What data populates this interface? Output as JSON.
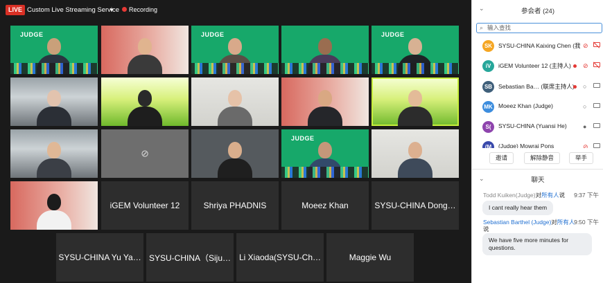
{
  "topbar": {
    "live_badge": "LIVE",
    "stream_label": "Custom Live Streaming Service",
    "recording_label": "Recording"
  },
  "tiles": {
    "volunteer": "iGEM Volunteer 12",
    "shriya": "Shriya PHADNIS",
    "moeez": "Moeez Khan",
    "sysu_dong": "SYSU-CHINA Dong…",
    "sysu_yu": "SYSU-CHINA Yu Ya…",
    "sysu_siju": "SYSU-CHINA（Siju…",
    "li_xiaoda": "Li Xiaoda(SYSU-Ch…",
    "maggie": "Maggie Wu",
    "judge_logo": "JUDGE"
  },
  "participants_panel": {
    "title": "参会者 (24)",
    "search_placeholder": "输入查找",
    "participants": [
      {
        "initials": "SK",
        "color": "#f5a623",
        "name": "SYSU-CHINA Kaixing Chen (我)",
        "recording": false,
        "mic": "muted",
        "cam": "off"
      },
      {
        "initials": "iV",
        "color": "#26a69a",
        "name": "iGEM Volunteer 12 (主持人)",
        "recording": true,
        "mic": "muted",
        "cam": "off"
      },
      {
        "initials": "SB",
        "color": "#3f5f7a",
        "name": "Sebastian Ba… (联席主持人)",
        "recording": true,
        "mic": "on",
        "cam": "on"
      },
      {
        "initials": "MK",
        "color": "#3c8dde",
        "name": "Moeez Khan (Judge)",
        "recording": false,
        "mic": "on",
        "cam": "on"
      },
      {
        "initials": "S(",
        "color": "#8e44ad",
        "name": "SYSU-CHINA (Yuansi He)",
        "recording": false,
        "mic": "active",
        "cam": "on"
      },
      {
        "initials": "(M",
        "color": "#3949ab",
        "name": "(Judge) Mowrai Pons",
        "recording": false,
        "mic": "muted",
        "cam": "on"
      }
    ],
    "buttons": {
      "invite": "邀请",
      "unmute_all": "解除静音",
      "raise_hand": "举手"
    }
  },
  "chat": {
    "title": "聊天",
    "messages": [
      {
        "sender": "Todd Kuiken(Judge)",
        "to_word": "对",
        "target": "所有人",
        "suffix": "说",
        "time": "9:37 下午",
        "text": "I cant really hear them"
      },
      {
        "sender": "Sebastian Barthel (Judge)",
        "to_word": "对",
        "target": "所有人",
        "suffix": "说",
        "time": "9:50 下午",
        "text": "We have five more minutes for questions."
      }
    ]
  },
  "colors": {
    "live_red": "#d93025",
    "judge_green": "#17a86a",
    "active_speaker_outline": "#c8f03c",
    "link_blue": "#1f6fd1"
  }
}
